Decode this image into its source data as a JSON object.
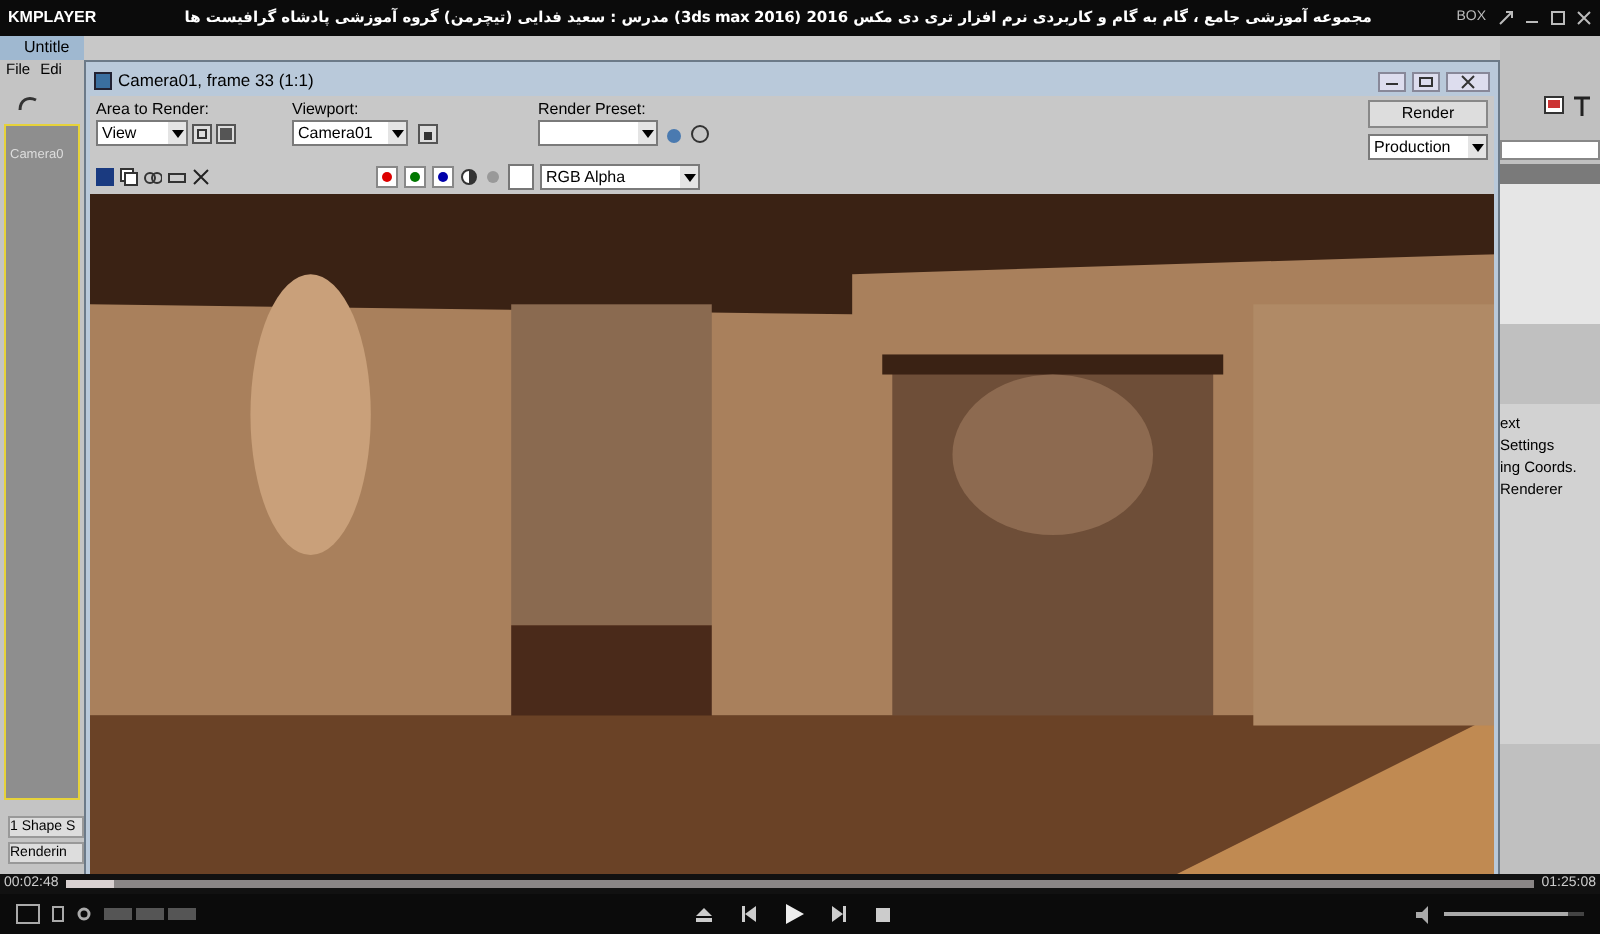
{
  "player": {
    "logo": "KMPLAYER",
    "title": "مجموعه آموزشی جامع ، گام به گام و کاربردی نرم افزار تری دی مکس 2016 (3ds max 2016) مدرس : سعید فدایی (تیچرمن) گروه آموزشی پادشاه گرافیست ها",
    "badge": "BOX"
  },
  "max_left": {
    "window_title": "Untitle",
    "menu": [
      "File",
      "Edi"
    ],
    "viewport_label": "Camera0",
    "rows": [
      "1 Shape S",
      "Renderin"
    ]
  },
  "max_right": {
    "items": [
      "ext",
      "Settings",
      "ing Coords.",
      "Renderer"
    ]
  },
  "render_window": {
    "title": "Camera01, frame 33 (1:1)",
    "area_label": "Area to Render:",
    "area_value": "View",
    "viewport_label": "Viewport:",
    "viewport_value": "Camera01",
    "preset_label": "Render Preset:",
    "render_button": "Render",
    "mode_value": "Production",
    "channel_value": "RGB Alpha"
  },
  "playback": {
    "elapsed": "00:02:48",
    "total": "01:25:08",
    "seek": {
      "level": 0.033
    },
    "volume": {
      "level": 0.88
    }
  }
}
